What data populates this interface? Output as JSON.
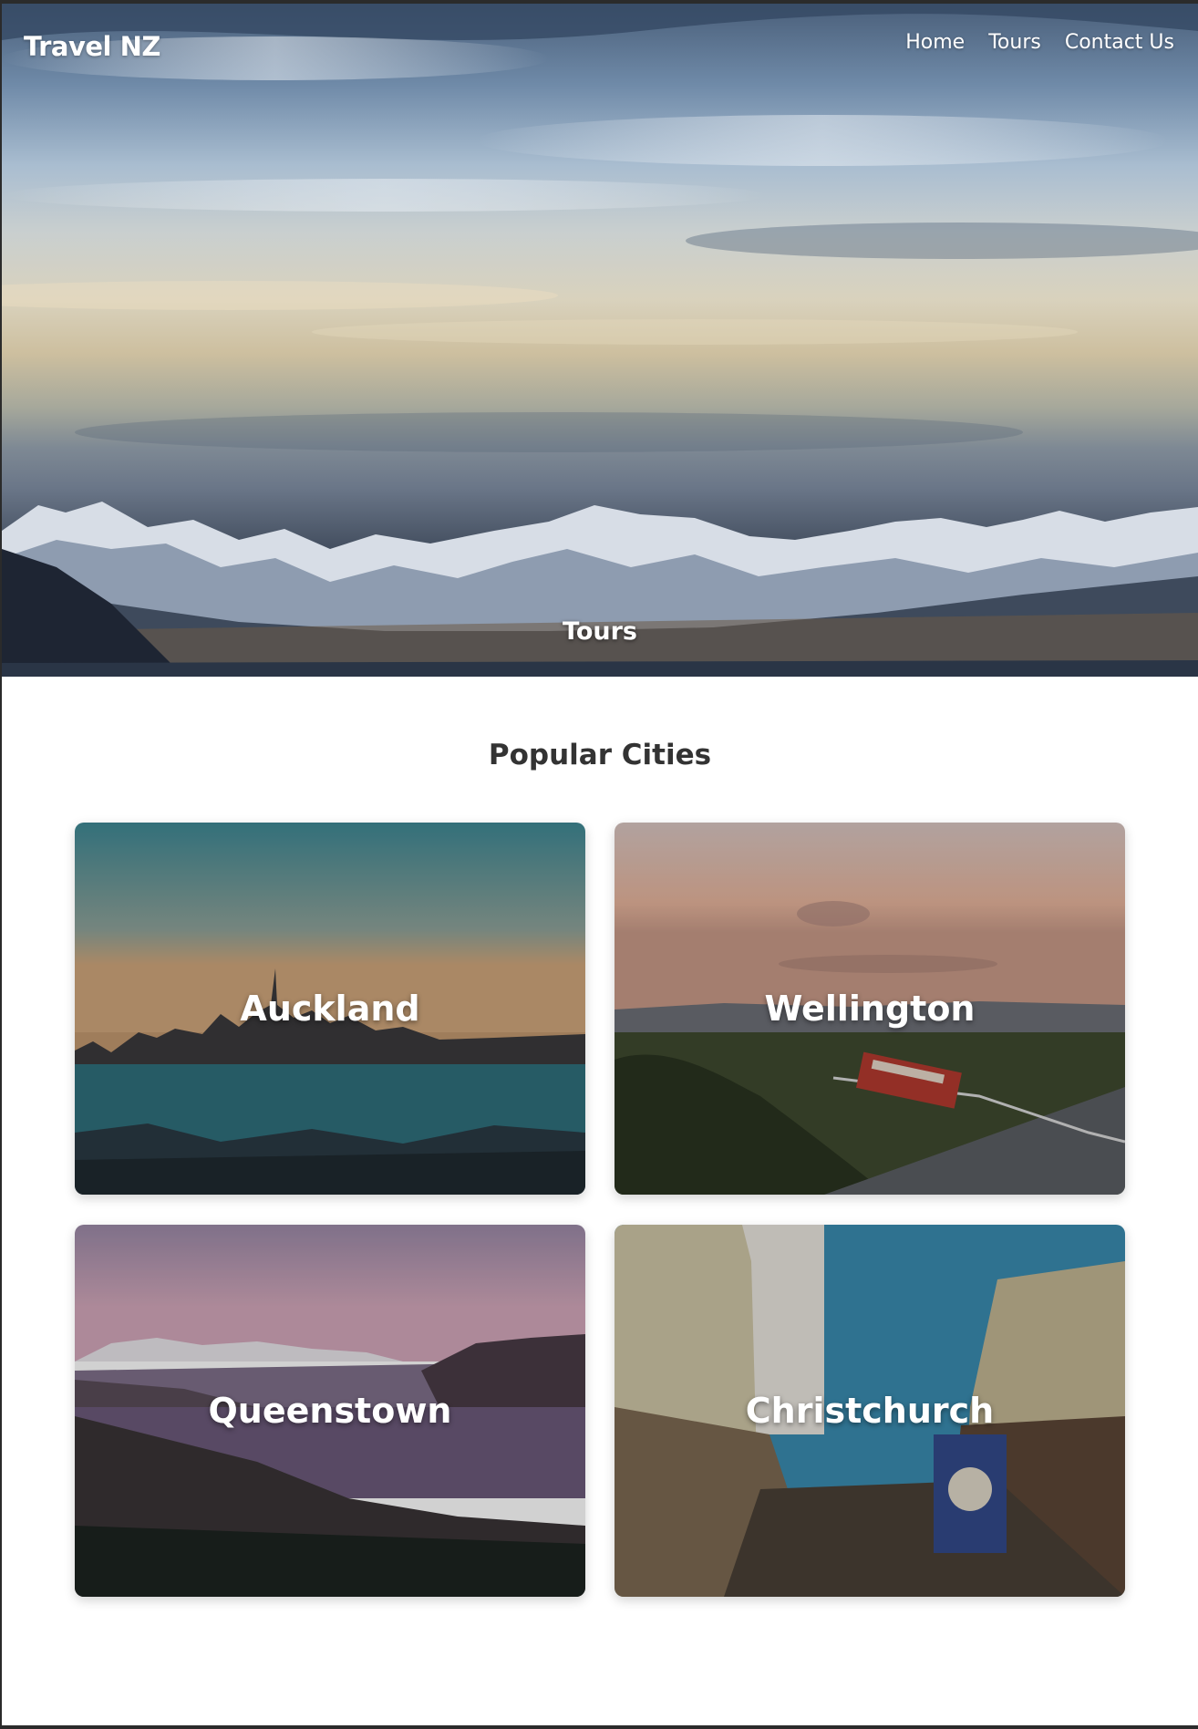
{
  "header": {
    "logo": "Travel NZ",
    "nav": [
      "Home",
      "Tours",
      "Contact Us"
    ]
  },
  "hero": {
    "title": "Tours"
  },
  "popular": {
    "heading": "Popular Cities",
    "cities": [
      "Auckland",
      "Wellington",
      "Queenstown",
      "Christchurch"
    ]
  }
}
